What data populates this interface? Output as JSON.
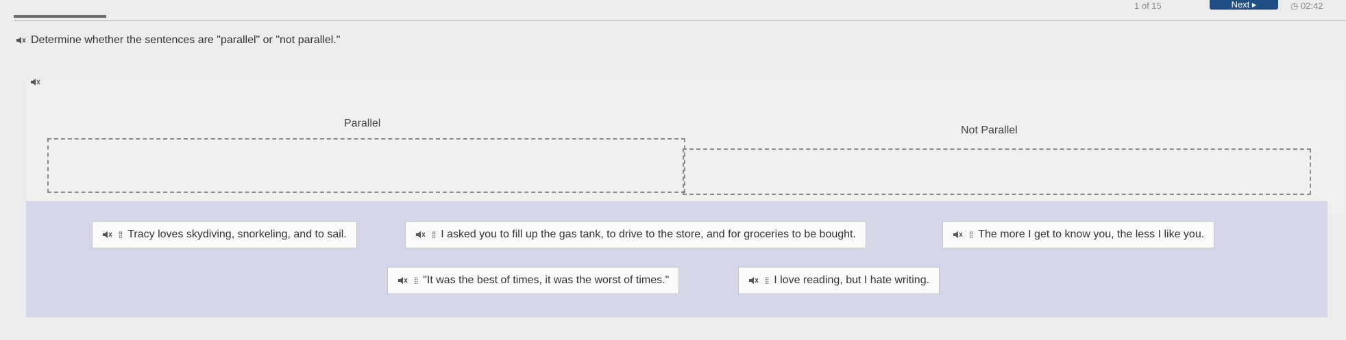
{
  "header": {
    "counter": "1 of 15",
    "next_label": "Next ▸",
    "timer": "◷ 02:42"
  },
  "instruction": "Determine whether the sentences are \"parallel\" or \"not parallel.\"",
  "columns": {
    "left_label": "Parallel",
    "right_label": "Not Parallel"
  },
  "tiles": [
    {
      "text": "Tracy loves skydiving, snorkeling, and to sail."
    },
    {
      "text": "I asked you to fill up the gas tank, to drive to the store, and for groceries to be bought."
    },
    {
      "text": "The more I get to know you, the less I like you."
    },
    {
      "text": "\"It was the best of times, it was the worst of times.\""
    },
    {
      "text": "I love reading, but I hate writing."
    }
  ],
  "icons": {
    "speaker": "speaker-icon",
    "drag_handle": "drag-handle-icon"
  },
  "colors": {
    "next_button": "#1f4f84",
    "bank_background": "#d5d6ea"
  }
}
